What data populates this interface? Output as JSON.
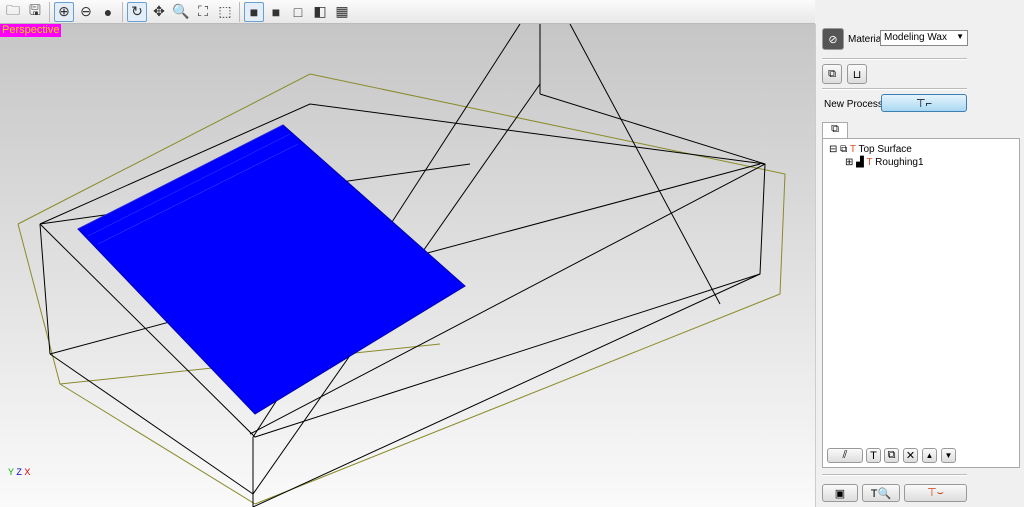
{
  "toolbar": {
    "buttons": [
      "open-icon",
      "save-icon",
      "wireframe-globe-icon",
      "shaded-globe-icon",
      "sphere-icon",
      "rotate-icon",
      "pan-icon",
      "zoom-icon",
      "fit-icon",
      "zoom-box-icon",
      "iso-view-icon",
      "front-view-icon",
      "right-view-icon",
      "top-view-icon",
      "multi-view-icon"
    ]
  },
  "viewport": {
    "mode_label": "Perspective",
    "axes": {
      "y": "Y",
      "z": "Z",
      "x": "X"
    }
  },
  "panel": {
    "material_label": "Material",
    "material_value": "Modeling Wax",
    "new_process_label": "New Process",
    "tree": {
      "root": "Top Surface",
      "child": "Roughing1"
    }
  },
  "colors": {
    "toolpath": "#0000ff",
    "perspective_bg": "#ff00ff",
    "perspective_text": "#ffd800"
  }
}
